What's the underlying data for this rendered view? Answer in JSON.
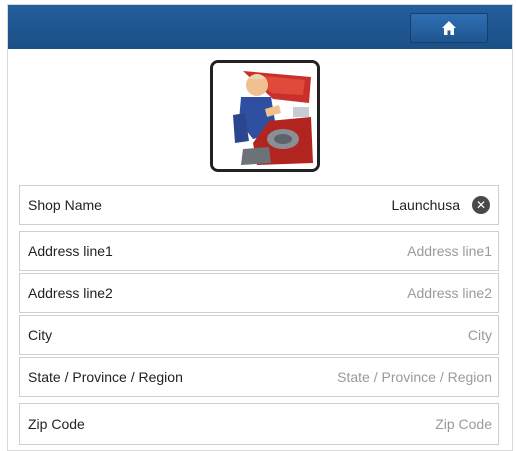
{
  "header": {
    "home_icon": "home-icon"
  },
  "avatar": {
    "icon": "mechanic-illustration"
  },
  "form": {
    "shop_name": {
      "label": "Shop Name",
      "value": "Launchusa",
      "clear_icon": "clear-icon"
    },
    "address1": {
      "label": "Address line1",
      "placeholder": "Address line1"
    },
    "address2": {
      "label": "Address line2",
      "placeholder": "Address line2"
    },
    "city": {
      "label": "City",
      "placeholder": "City"
    },
    "state": {
      "label": "State / Province / Region",
      "placeholder": "State / Province / Region"
    },
    "zip": {
      "label": "Zip Code",
      "placeholder": "Zip Code"
    }
  },
  "colors": {
    "header": "#1f5590",
    "home_button": "#2a66a6",
    "placeholder": "#9a9a9a"
  }
}
